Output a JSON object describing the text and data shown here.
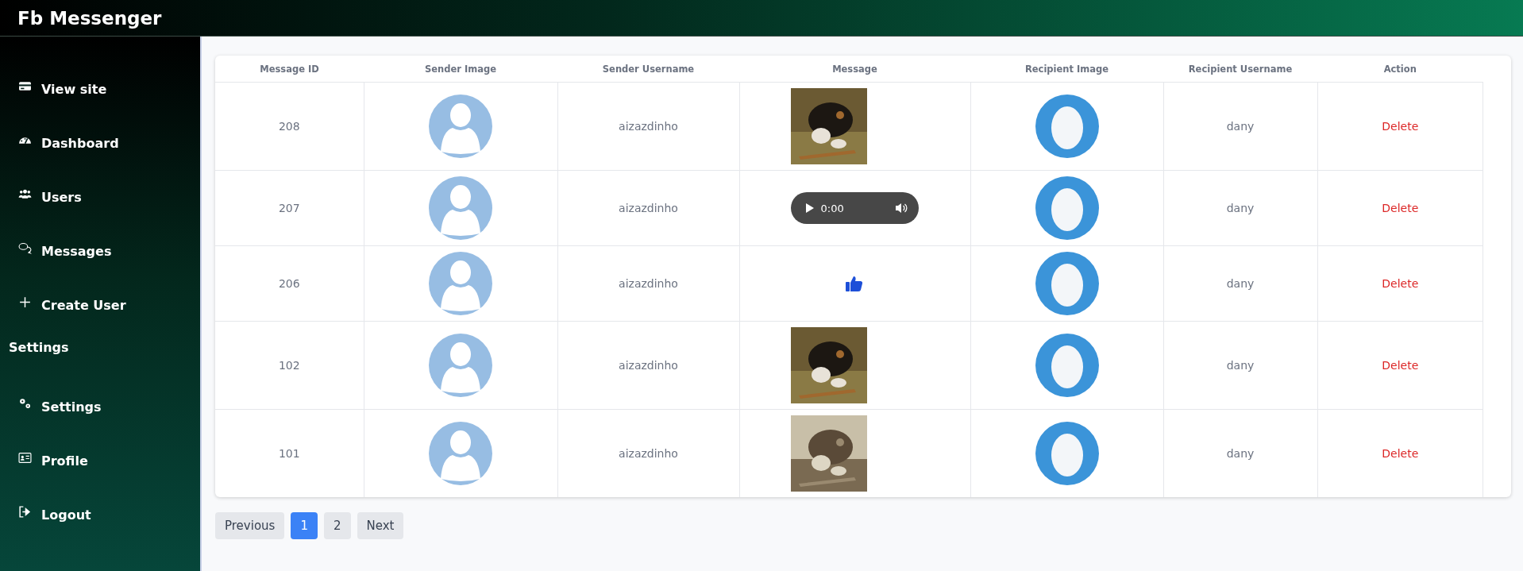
{
  "header": {
    "title": "Fb Messenger"
  },
  "sidebar": {
    "items": [
      {
        "label": "View site"
      },
      {
        "label": "Dashboard"
      },
      {
        "label": "Users"
      },
      {
        "label": "Messages"
      },
      {
        "label": "Create User"
      }
    ],
    "section_title": "Settings",
    "section_items": [
      {
        "label": "Settings"
      },
      {
        "label": "Profile"
      },
      {
        "label": "Logout"
      }
    ]
  },
  "table": {
    "columns": [
      "Message ID",
      "Sender Image",
      "Sender Username",
      "Message",
      "Recipient Image",
      "Recipient Username",
      "Action"
    ],
    "rows": [
      {
        "id": "208",
        "sender": "aizazdinho",
        "recipient": "dany",
        "action": "Delete"
      },
      {
        "id": "207",
        "sender": "aizazdinho",
        "message": {
          "kind": "audio",
          "time": "0:00"
        },
        "recipient": "dany",
        "action": "Delete"
      },
      {
        "id": "206",
        "sender": "aizazdinho",
        "message": {
          "kind": "like"
        },
        "recipient": "dany",
        "action": "Delete"
      },
      {
        "id": "102",
        "sender": "aizazdinho",
        "recipient": "dany",
        "action": "Delete"
      },
      {
        "id": "101",
        "sender": "aizazdinho",
        "recipient": "dany",
        "action": "Delete"
      }
    ]
  },
  "pagination": {
    "previous": "Previous",
    "pages": [
      {
        "label": "1",
        "selected": true
      },
      {
        "label": "2",
        "selected": false
      }
    ],
    "next": "Next"
  }
}
